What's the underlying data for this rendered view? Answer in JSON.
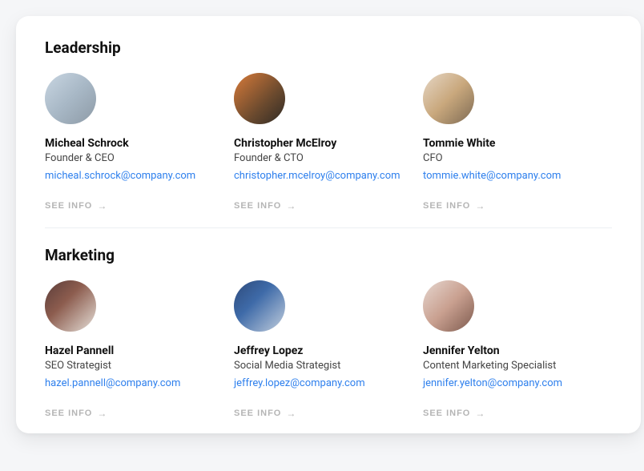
{
  "sections": [
    {
      "title": "Leadership",
      "people": [
        {
          "name": "Micheal Schrock",
          "role": "Founder & CEO",
          "email": "micheal.schrock@company.com",
          "seeInfo": "SEE INFO"
        },
        {
          "name": "Christopher McElroy",
          "role": "Founder & CTO",
          "email": "christopher.mcelroy@company.com",
          "seeInfo": "SEE INFO"
        },
        {
          "name": "Tommie White",
          "role": "CFO",
          "email": "tommie.white@company.com",
          "seeInfo": "SEE INFO"
        }
      ]
    },
    {
      "title": "Marketing",
      "people": [
        {
          "name": "Hazel Pannell",
          "role": "SEO Strategist",
          "email": "hazel.pannell@company.com",
          "seeInfo": "SEE INFO"
        },
        {
          "name": "Jeffrey Lopez",
          "role": "Social Media Strategist",
          "email": "jeffrey.lopez@company.com",
          "seeInfo": "SEE INFO"
        },
        {
          "name": "Jennifer Yelton",
          "role": "Content Marketing Specialist",
          "email": "jennifer.yelton@company.com",
          "seeInfo": "SEE INFO"
        }
      ]
    }
  ]
}
